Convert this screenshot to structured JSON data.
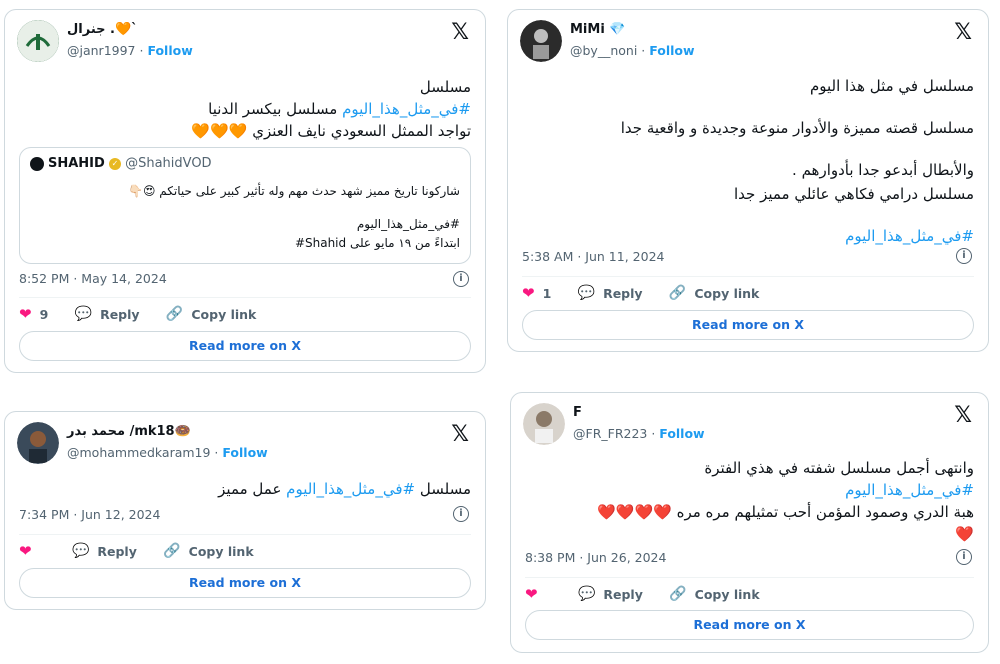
{
  "t1": {
    "name": "جنرال .🧡`",
    "handle": "@janr1997",
    "follow": "Follow",
    "line1": "مسلسل",
    "line2_tag": "#في_مثل_هذا_اليوم",
    "line2_rest": " مسلسل بيكسر الدنيا",
    "line3": "تواجد الممثل السعودي نايف العنزي 🧡🧡🧡",
    "quote_name": "SHAHID",
    "quote_handle": "@ShahidVOD",
    "quote_line1": "شاركونا تاريخ مميز شهد حدث مهم وله تأثير كبير على حياتكم 😍👇🏻",
    "quote_line2": "#في_مثل_هذا_اليوم",
    "quote_line3": "ابتداءً من ١٩ مايو على Shahid#",
    "time": "8:52 PM · May 14, 2024",
    "likes": "9",
    "reply": "Reply",
    "copy": "Copy link",
    "readmore": "Read more on X"
  },
  "t2": {
    "name": "MiMi 💎",
    "handle": "@by__noni",
    "follow": "Follow",
    "line1": "مسلسل  في مثل هذا اليوم",
    "line2": "مسلسل قصته مميزة والأدوار منوعة وجديدة و واقعية جدا",
    "line3": "والأبطال أبدعو جدا بأدوارهم .",
    "line4": "مسلسل درامي فكاهي عائلي مميز جدا",
    "tag": "#في_مثل_هذا_اليوم",
    "time": "5:38 AM · Jun 11, 2024",
    "likes": "1",
    "reply": "Reply",
    "copy": "Copy link",
    "readmore": "Read more on X"
  },
  "t3": {
    "name": "محمد بدر /mk18🍩",
    "handle": "@mohammedkaram19",
    "follow": "Follow",
    "pre": "مسلسل ",
    "tag": "#في_مثل_هذا_اليوم",
    "post": " عمل مميز",
    "time": "7:34 PM · Jun 12, 2024",
    "reply": "Reply",
    "copy": "Copy link",
    "readmore": "Read more on X"
  },
  "t4": {
    "name": "F",
    "handle": "@FR_FR223",
    "follow": "Follow",
    "line1": "وانتهى أجمل مسلسل شفته في هذي الفترة",
    "tag": "#في_مثل_هذا_اليوم",
    "line3": "هبة الدري وصمود المؤمن أحب تمثيلهم مره مره ❤️❤️❤️❤️",
    "line4": "❤️",
    "time": "8:38 PM · Jun 26, 2024",
    "reply": "Reply",
    "copy": "Copy link",
    "readmore": "Read more on X"
  },
  "icons": {
    "x": "x-logo-icon",
    "info": "info-icon",
    "heart": "heart-icon",
    "reply": "reply-icon",
    "link": "link-icon"
  },
  "colors": {
    "accent": "#1d9bf0",
    "heart": "#f91880",
    "border": "#cfd9de"
  }
}
